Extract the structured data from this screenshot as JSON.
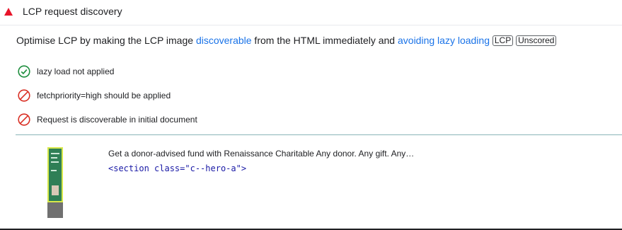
{
  "header": {
    "title": "LCP request discovery"
  },
  "description": {
    "prefix": "Optimise LCP by making the LCP image ",
    "link1": "discoverable",
    "middle": " from the HTML immediately and ",
    "link2": "avoiding lazy loading",
    "badge1": "LCP",
    "badge2": "Unscored"
  },
  "checks": [
    {
      "label": "lazy load not applied",
      "status": "pass",
      "icon": "check-circle-icon"
    },
    {
      "label": "fetchpriority=high should be applied",
      "status": "fail",
      "icon": "blocked-circle-icon"
    },
    {
      "label": "Request is discoverable in initial document",
      "status": "fail",
      "icon": "blocked-circle-icon"
    }
  ],
  "node": {
    "snippet": "Get a donor-advised fund with Renaissance Charitable Any donor. Any gift. Any…",
    "selector": "<section class=\"c--hero-a\">"
  },
  "colors": {
    "pass": "#1e8e3e",
    "fail": "#d93025",
    "warn": "#e8152a",
    "link": "#1a73e8"
  }
}
